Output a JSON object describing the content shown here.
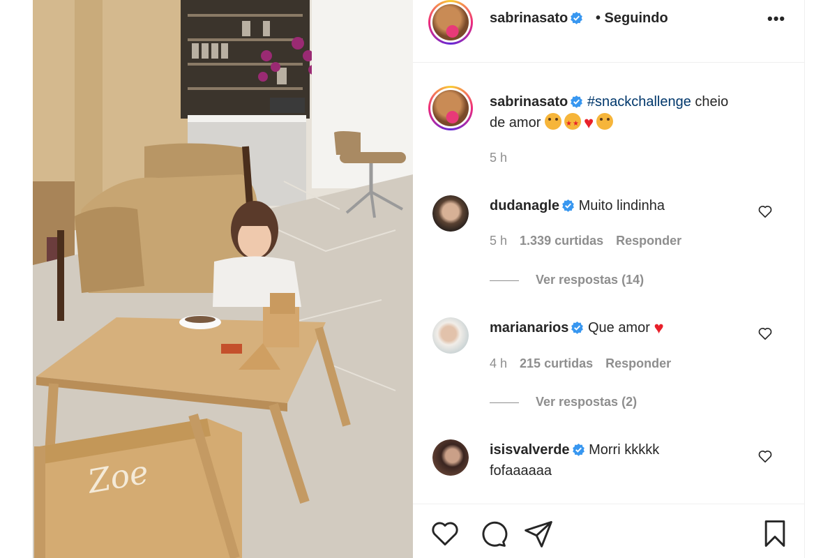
{
  "post": {
    "author": "sabrinasato",
    "follow_status": "• Seguindo",
    "more_label": "•••",
    "caption": {
      "author": "sabrinasato",
      "hashtag": "#snackchallenge",
      "text_line1": " cheio",
      "text_line2": "de amor",
      "emojis": [
        "face-blowing-kiss-emoji",
        "star-struck-emoji",
        "red-heart-emoji",
        "grinning-face-emoji"
      ],
      "time": "5 h"
    },
    "photo": {
      "chair_engraving": "Zoe"
    }
  },
  "comments": [
    {
      "user": "dudanagle",
      "text": "Muito lindinha",
      "time": "5 h",
      "likes": "1.339 curtidas",
      "reply": "Responder",
      "replies": "Ver respostas (14)"
    },
    {
      "user": "marianarios",
      "text": "Que amor",
      "emoji": "red-heart-emoji",
      "time": "4 h",
      "likes": "215 curtidas",
      "reply": "Responder",
      "replies": "Ver respostas (2)"
    },
    {
      "user": "isisvalverde",
      "text_line1": "Morri kkkkk",
      "text_line2": "fofaaaaaa"
    }
  ],
  "actions": [
    "heart-icon",
    "comment-icon",
    "share-icon",
    "bookmark-icon"
  ],
  "colors": {
    "text": "#262626",
    "secondary": "#8e8e8e",
    "hashtag": "#00376b",
    "verified": "#3897f0",
    "border": "#efefef"
  }
}
